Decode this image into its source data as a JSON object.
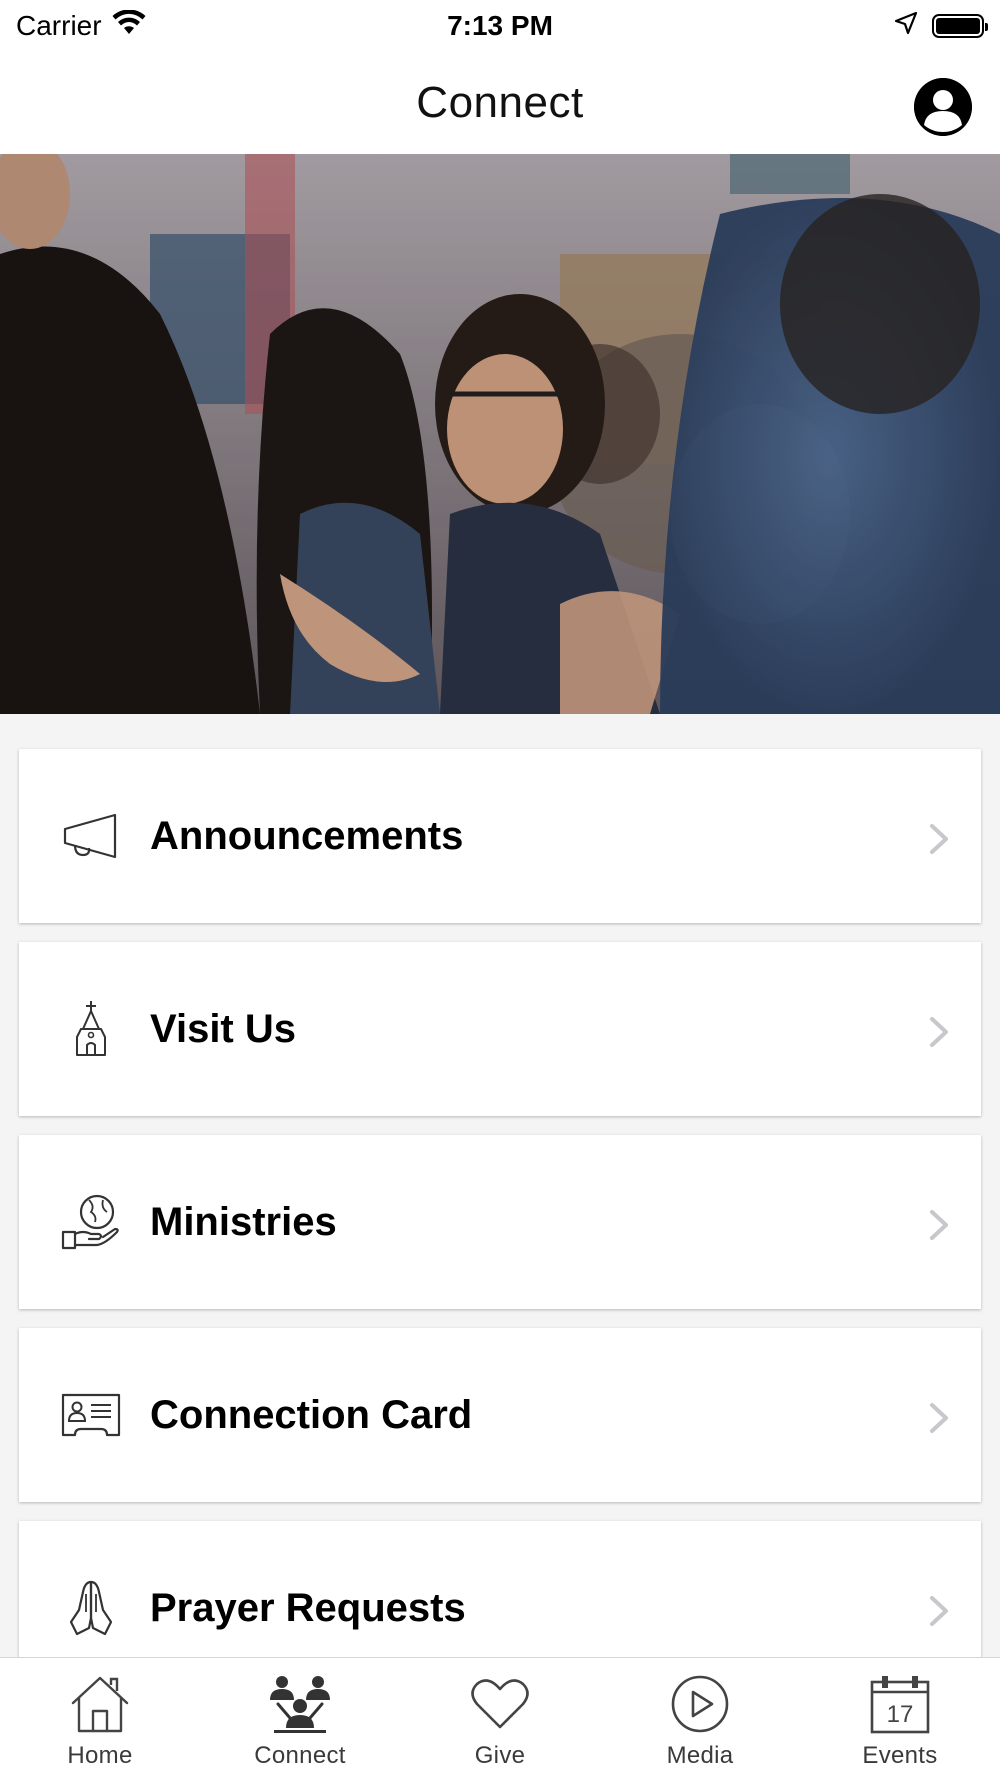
{
  "status_bar": {
    "carrier": "Carrier",
    "time": "7:13 PM"
  },
  "nav": {
    "title": "Connect"
  },
  "hero": {
    "image_description": "Two women hugging in a crowded church hall"
  },
  "menu": [
    {
      "label": "Announcements",
      "icon": "megaphone-icon"
    },
    {
      "label": "Visit Us",
      "icon": "church-icon"
    },
    {
      "label": "Ministries",
      "icon": "hand-globe-icon"
    },
    {
      "label": "Connection Card",
      "icon": "id-card-icon"
    },
    {
      "label": "Prayer Requests",
      "icon": "praying-hands-icon"
    }
  ],
  "tabs": [
    {
      "label": "Home",
      "icon": "home-icon"
    },
    {
      "label": "Connect",
      "icon": "people-icon"
    },
    {
      "label": "Give",
      "icon": "heart-icon"
    },
    {
      "label": "Media",
      "icon": "play-icon"
    },
    {
      "label": "Events",
      "icon": "calendar-icon",
      "calendar_day": "17"
    }
  ],
  "colors": {
    "background": "#f4f4f4",
    "card": "#ffffff",
    "chevron": "#c7c7cc",
    "tab_label": "#3a3a3a"
  }
}
